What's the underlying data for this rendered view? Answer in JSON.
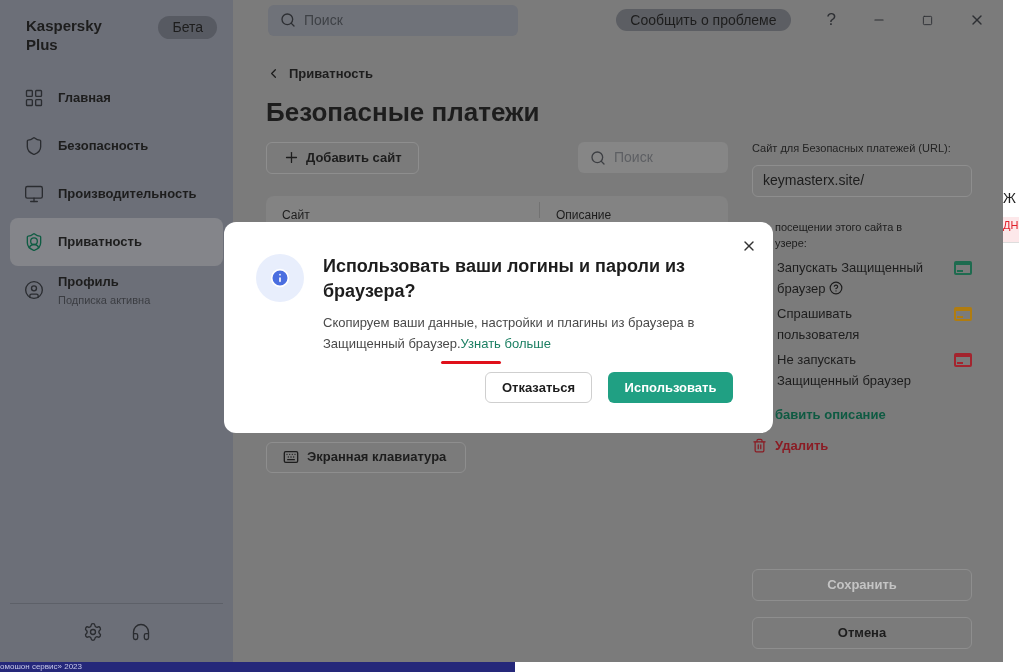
{
  "sidebar": {
    "brand": "Kaspersky Plus",
    "badge": "Бета",
    "items": [
      {
        "label": "Главная",
        "selected": false
      },
      {
        "label": "Безопасность",
        "selected": false
      },
      {
        "label": "Производительность",
        "selected": false
      },
      {
        "label": "Приватность",
        "selected": true
      },
      {
        "label": "Профиль",
        "subtitle": "Подписка активна",
        "selected": false
      }
    ]
  },
  "topbar": {
    "search_placeholder": "Поиск",
    "report_button": "Сообщить о проблеме",
    "help": "?"
  },
  "breadcrumb": "Приватность",
  "title": "Безопасные платежи",
  "add_site_button": "Добавить сайт",
  "table_search_placeholder": "Поиск",
  "table": {
    "columns": [
      "Сайт",
      "Описание"
    ]
  },
  "keyboard_button": "Экранная клавиатура",
  "details": {
    "url_label": "Сайт для Безопасных платежей (URL):",
    "url_value": "keymasterx.site/",
    "prompt_lines": [
      "посещении этого сайта в",
      "узере:"
    ],
    "options": [
      {
        "label": "Запускать Защищенный браузер",
        "help": true,
        "color": "#1e6b4f"
      },
      {
        "label": "Спрашивать пользователя",
        "help": false,
        "color": "#b07c10"
      },
      {
        "label": "Не запускать Защищенный браузер",
        "help": false,
        "color": "#a3242e"
      }
    ],
    "add_description": "бавить описание",
    "delete": "Удалить",
    "save_button": {
      "label": "Сохранить",
      "disabled": true
    },
    "cancel_button": "Отмена"
  },
  "dialog": {
    "title": "Использовать ваши логины и пароли из браузера?",
    "body": "Скопируем ваши данные, настройки и плагины из браузера в Защищенный браузер.",
    "link": "Узнать больше",
    "buttons": [
      {
        "label": "Отказаться",
        "kind": "secondary"
      },
      {
        "label": "Использовать",
        "kind": "primary"
      }
    ]
  },
  "background_page": {
    "fragments": [
      {
        "text": "Ж",
        "kind": "heading"
      },
      {
        "text": "ДН",
        "kind": "alert"
      }
    ]
  },
  "footer_strip": "омошон сервис» 2023"
}
